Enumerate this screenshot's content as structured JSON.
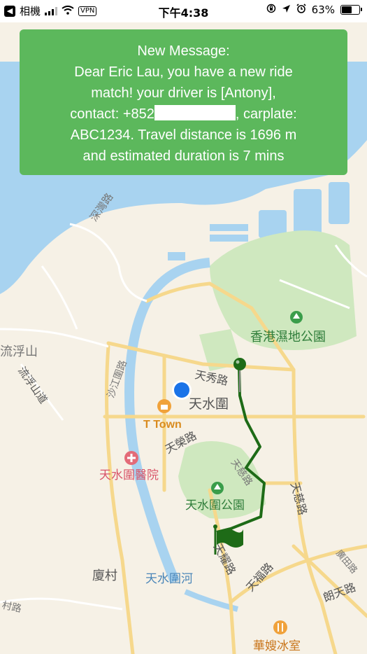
{
  "status_bar": {
    "back_app": "相機",
    "vpn": "VPN",
    "time": "下午4:38",
    "battery_text": "63%",
    "battery_level": 0.63
  },
  "notification": {
    "title": "New Message:",
    "line1": "Dear Eric Lau, you have a new ride",
    "line2": "match! your driver is [Antony],",
    "contact_prefix": "contact: +852",
    "contact_suffix": ", carplate:",
    "line4": "ABC1234. Travel distance is 1696 m",
    "line5": "and estimated duration is 7 mins",
    "bg_color": "#5cb85c"
  },
  "map": {
    "labels": {
      "road_shenwan": "深灣路",
      "road_tinyiu": "天秀路",
      "area_tinshuiwai": "天水圍",
      "poi_ttown": "T Town",
      "poi_wetland": "香港濕地公園",
      "road_shagong": "沙江圍路",
      "road_tinwing": "天榮路",
      "road_tintsz": "天慈路",
      "road_tintsz2": "天慈路",
      "poi_hospital": "天水圍醫院",
      "poi_park": "天水圍公園",
      "area_hahtsuen": "廈村",
      "river": "天水圍河",
      "road_tinyiu2": "天耀路",
      "road_tinfuk": "天福路",
      "road_kwongtin": "廣田路",
      "road_longtin": "朗天路",
      "road_tsuen": "村路",
      "area_shan": "流浮山",
      "road_lfs": "流浮山道",
      "poi_cafe": "華嫂冰室"
    },
    "route_color": "#1e6b17",
    "water_color": "#a8d3f0",
    "park_color": "#cfe8bf"
  }
}
